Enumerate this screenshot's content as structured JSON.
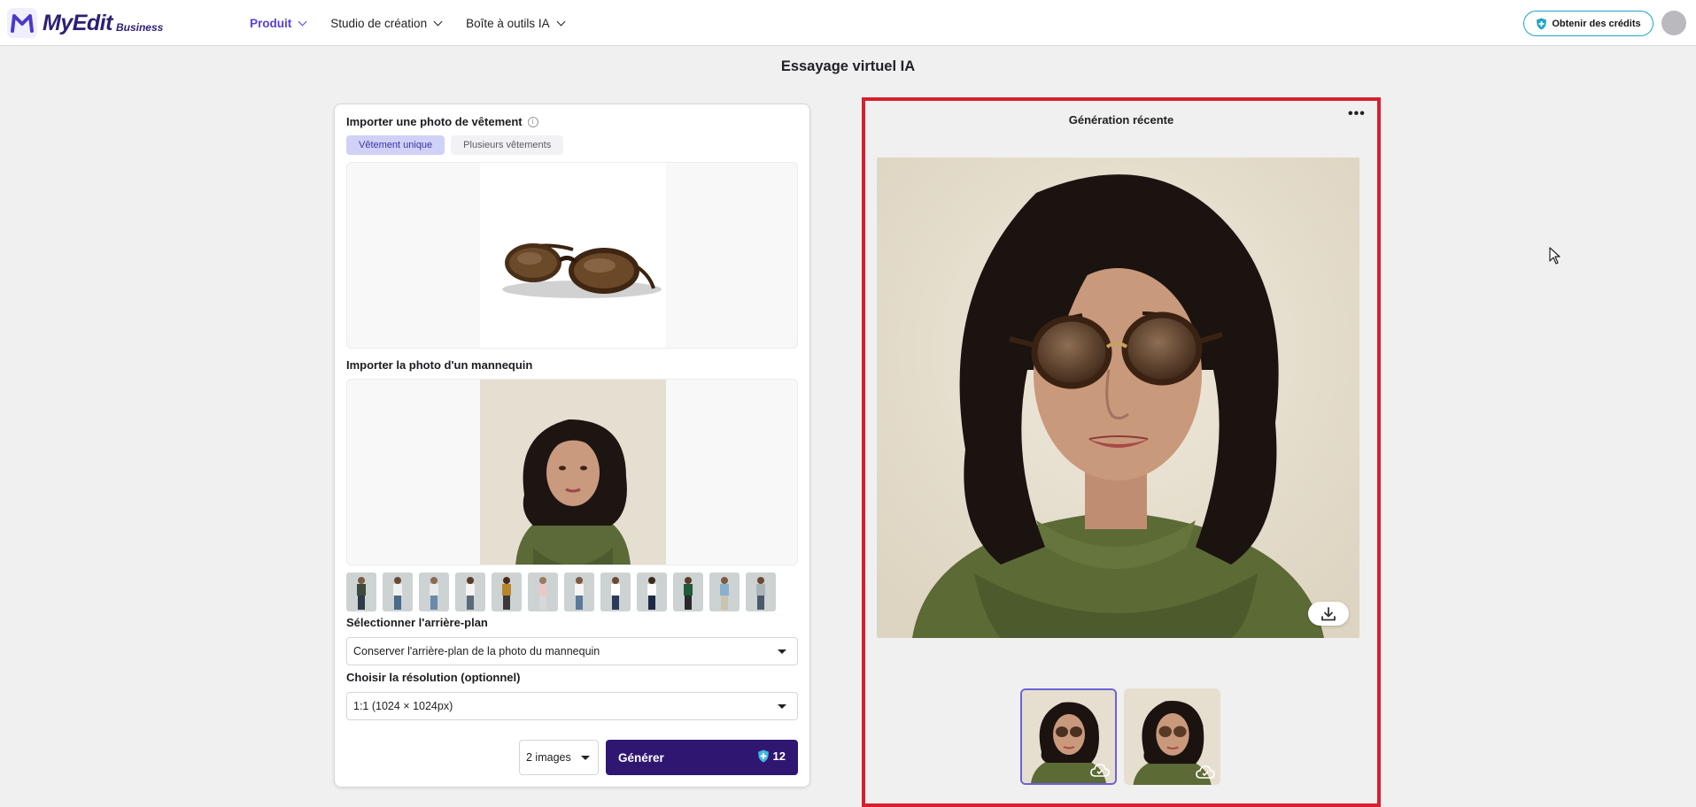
{
  "header": {
    "logo_text": "MyEdit",
    "logo_sub": "Business",
    "nav": [
      {
        "label": "Produit"
      },
      {
        "label": "Studio de création"
      },
      {
        "label": "Boîte à outils IA"
      }
    ],
    "credits_label": "Obtenir des crédits"
  },
  "page": {
    "title": "Essayage virtuel IA"
  },
  "left": {
    "garment_label": "Importer une photo de vêtement",
    "tabs": [
      {
        "label": "Vêtement unique",
        "active": true
      },
      {
        "label": "Plusieurs vêtements",
        "active": false
      }
    ],
    "model_label": "Importer la photo d'un mannequin",
    "model_presets_count": 12,
    "background_label": "Sélectionner l'arrière-plan",
    "background_value": "Conserver l'arrière-plan de la photo du mannequin",
    "resolution_label": "Choisir la résolution (optionnel)",
    "resolution_value": "1:1 (1024 × 1024px)",
    "count_value": "2 images",
    "generate_label": "Générer",
    "generate_cost": "12"
  },
  "right": {
    "title": "Génération récente",
    "more_label": "•••"
  },
  "colors": {
    "brand": "#2e1671",
    "accent": "#5a3fd6",
    "highlight_border": "#d6202e",
    "tab_active_bg": "#cfd1f7"
  },
  "icons": [
    "logo-icon",
    "chevron-down-icon",
    "credit-shield-icon",
    "info-icon",
    "caret-down-icon",
    "download-icon",
    "cloud-icon",
    "more-icon",
    "cursor-icon"
  ]
}
